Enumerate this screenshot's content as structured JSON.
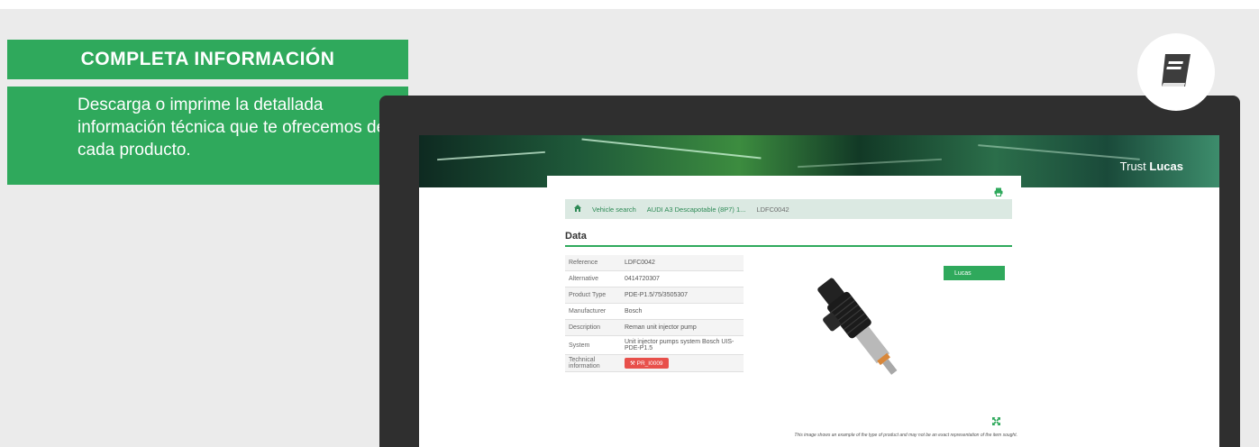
{
  "promo": {
    "title": "COMPLETA INFORMACIÓN",
    "body": "Descarga o imprime la detallada información técnica que te ofrecemos de cada producto."
  },
  "badge": {
    "icon": "book-icon"
  },
  "site": {
    "brand_prefix": "Trust",
    "brand_name": "Lucas",
    "print_icon": "printer-icon"
  },
  "breadcrumb": {
    "home_icon": "home-icon",
    "items": [
      "Vehicle search",
      "AUDI A3 Descapotable (8P7) 1..."
    ],
    "current": "LDFC0042"
  },
  "data_section": {
    "title": "Data",
    "rows": [
      {
        "label": "Reference",
        "value": "LDFC0042"
      },
      {
        "label": "Alternative",
        "value": "0414720307"
      },
      {
        "label": "Product Type",
        "value": "PDE-P1.5/75/3505307"
      },
      {
        "label": "Manufacturer",
        "value": "Bosch"
      },
      {
        "label": "Description",
        "value": "Reman unit injector pump"
      },
      {
        "label": "System",
        "value": "Unit injector pumps system Bosch UIS-PDE-P1.5"
      }
    ],
    "tech_label": "Technical information",
    "tech_button": "PR_I0009"
  },
  "product": {
    "brand_tag": "Lucas",
    "disclaimer": "This image shows an example of the type of product and may not be an exact representation of the item sought."
  },
  "colors": {
    "accent": "#2fa95c",
    "tech_button": "#e8504b",
    "monitor": "#2f2f2f"
  }
}
